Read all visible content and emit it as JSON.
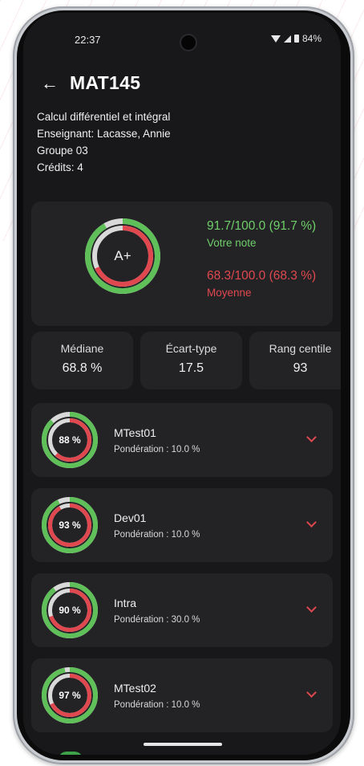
{
  "status": {
    "time": "22:37",
    "battery": "84%"
  },
  "header": {
    "course_code": "MAT145"
  },
  "info": {
    "title": "Calcul différentiel et intégral",
    "teacher": "Enseignant: Lacasse, Annie",
    "group": "Groupe 03",
    "credits": "Crédits: 4"
  },
  "grade": {
    "letter": "A+",
    "score": "91.7/100.0 (91.7 %)",
    "score_label": "Votre note",
    "score_fraction": 0.917,
    "average": "68.3/100.0 (68.3 %)",
    "average_label": "Moyenne",
    "average_fraction": 0.683
  },
  "stats": [
    {
      "label": "Médiane",
      "value": "68.8 %"
    },
    {
      "label": "Écart-type",
      "value": "17.5"
    },
    {
      "label": "Rang centile",
      "value": "93"
    }
  ],
  "evaluations": [
    {
      "name": "MTest01",
      "percent": "88 %",
      "weight": "Pondération : 10.0 %",
      "score_fraction": 0.88,
      "average_fraction": 0.62
    },
    {
      "name": "Dev01",
      "percent": "93 %",
      "weight": "Pondération : 10.0 %",
      "score_fraction": 0.93,
      "average_fraction": 0.92
    },
    {
      "name": "Intra",
      "percent": "90 %",
      "weight": "Pondération : 30.0 %",
      "score_fraction": 0.9,
      "average_fraction": 0.7
    },
    {
      "name": "MTest02",
      "percent": "97 %",
      "weight": "Pondération : 10.0 %",
      "score_fraction": 0.97,
      "average_fraction": 0.68
    }
  ],
  "colors": {
    "green": "#5fbf58",
    "red": "#e0484f",
    "track": "#d9d9d9",
    "text_green": "#6fcf6a",
    "text_red": "#e0484f"
  }
}
